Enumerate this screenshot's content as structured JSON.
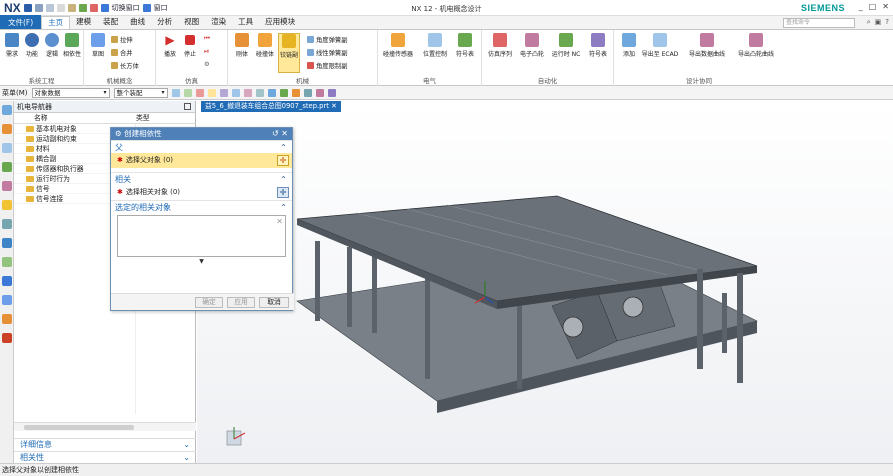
{
  "app": {
    "logo": "NX",
    "window_title": "NX 12 - 机电概念设计",
    "brand": "SIEMENS",
    "qat_window_label": "切换窗口",
    "qat_window2_label": "窗口"
  },
  "tabs": {
    "file": "文件(F)",
    "items": [
      "主页",
      "建模",
      "装配",
      "曲线",
      "分析",
      "视图",
      "渲染",
      "工具",
      "应用模块"
    ],
    "active": "主页",
    "search_placeholder": "查找命令"
  },
  "ribbon": {
    "groups": [
      {
        "label": "系统工程",
        "buttons": [
          "需求",
          "功能",
          "逻辑",
          "相依性"
        ]
      },
      {
        "label": "机械概念",
        "buttons": [
          "草图"
        ],
        "small": [
          "拉伸",
          "合并",
          "长方体"
        ]
      },
      {
        "label": "仿真",
        "buttons": [
          "播放",
          "停止"
        ]
      },
      {
        "label": "机械",
        "buttons": [
          "刚体",
          "碰撞体",
          "铰链副"
        ],
        "small": [
          "角度弹簧副",
          "线性弹簧副",
          "角度限制副"
        ]
      },
      {
        "label": "电气",
        "buttons": [
          "碰撞传感器",
          "位置控制",
          "符号表"
        ]
      },
      {
        "label": "自动化",
        "buttons": [
          "仿真序列",
          "电子凸轮",
          "运行时 NC",
          "符号表"
        ]
      },
      {
        "label": "设计协同",
        "buttons": [
          "添加",
          "导出至 ECAD",
          "导出数据曲线",
          "导出凸轮曲线"
        ]
      }
    ]
  },
  "selection_bar": {
    "menu": "菜单(M)",
    "filter": "对象数据",
    "scope": "整个装配"
  },
  "navigator": {
    "title": "机电导航器",
    "col_name": "名称",
    "col_type": "类型",
    "items": [
      "基本机电对象",
      "运动副和约束",
      "材料",
      "耦合副",
      "传感器和执行器",
      "运行时行为",
      "信号",
      "信号连接"
    ],
    "sections": [
      "详细信息",
      "相关性"
    ]
  },
  "viewport": {
    "doc_tab": "益5_6_撤退装车组合总图0907_step.prt"
  },
  "dialog": {
    "title": "创建相依性",
    "section_parent": "父",
    "select_parent": "选择父对象 (0)",
    "section_related": "相关",
    "select_related": "选择相关对象 (0)",
    "section_selected": "选定的相关对象",
    "btn_ok": "确定",
    "btn_apply": "应用",
    "btn_cancel": "取消"
  },
  "status": {
    "message": "选择父对象以创建相依性"
  }
}
